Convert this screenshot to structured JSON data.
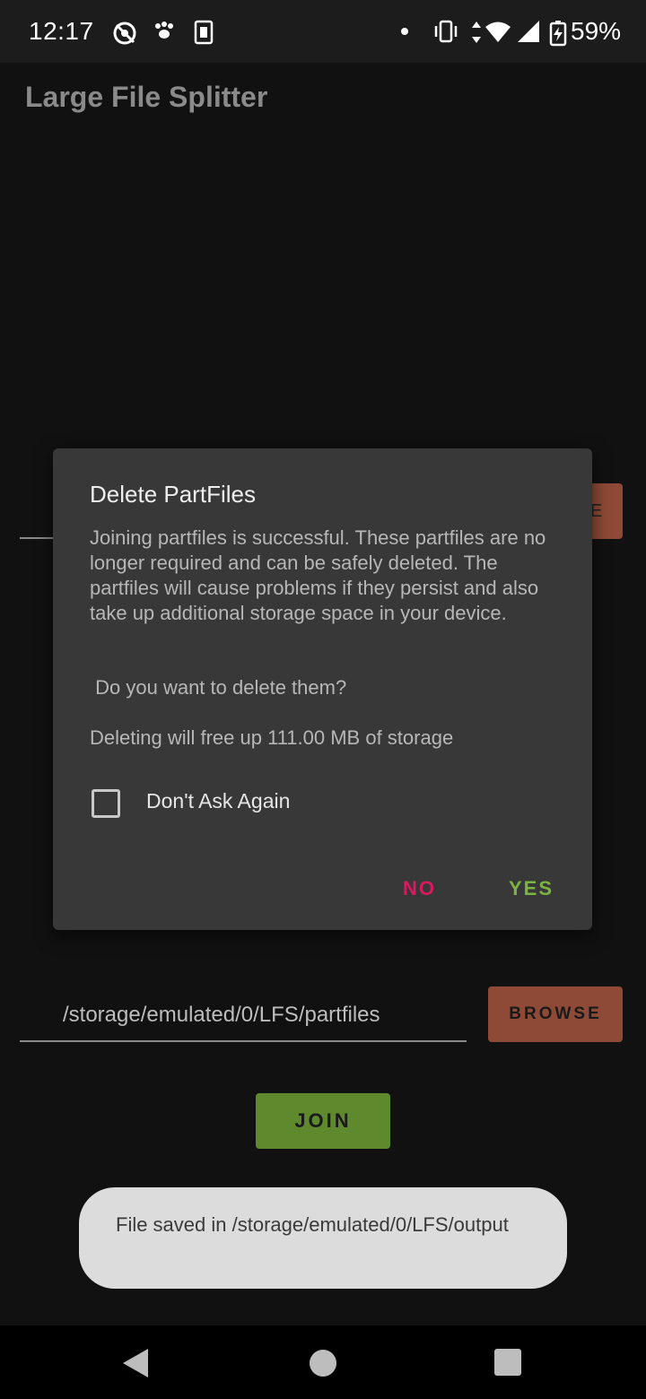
{
  "status_bar": {
    "time": "12:17",
    "battery": "59%",
    "icons": [
      "sync-off-icon",
      "paw-icon",
      "sim-card-icon",
      "dot-icon",
      "vibrate-icon",
      "data-arrows-icon",
      "wifi-icon",
      "signal-icon",
      "battery-charging-icon"
    ]
  },
  "app": {
    "title": "Large File Splitter"
  },
  "main": {
    "top_browse_fragment": "E",
    "path_value": "/storage/emulated/0/LFS/partfiles",
    "browse_label": "BROWSE",
    "join_label": "JOIN"
  },
  "dialog": {
    "title": "Delete PartFiles",
    "body": "Joining partfiles is successful. These partfiles are no longer required and can be safely deleted. The partfiles will cause problems if they persist and also take up additional storage space in your device.",
    "question": "Do you want to delete them?",
    "storage_note": "Deleting will free up 111.00 MB of storage",
    "checkbox_label": "Don't Ask Again",
    "checkbox_checked": false,
    "no_label": "NO",
    "yes_label": "YES"
  },
  "toast": {
    "text": "File saved in /storage/emulated/0/LFS/output"
  },
  "colors": {
    "no": "#d81b60",
    "yes": "#7cb342",
    "browse": "#8e4a36",
    "join": "#5e8a2d"
  }
}
